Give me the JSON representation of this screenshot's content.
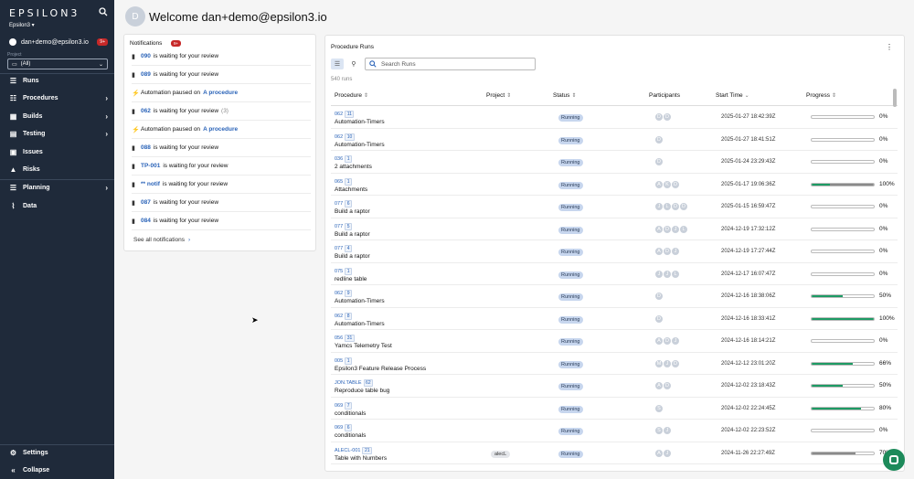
{
  "sidebar": {
    "logo": "EPSILON3",
    "org": "Epsilon3 ▾",
    "user": "dan+demo@epsilon3.io",
    "user_badge": "9+",
    "project_label": "Project",
    "project_value": "(All)",
    "items": [
      {
        "label": "Runs",
        "icon": "play-icon"
      },
      {
        "label": "Procedures",
        "icon": "list-icon"
      },
      {
        "label": "Builds",
        "icon": "cubes-icon"
      },
      {
        "label": "Testing",
        "icon": "clipboard-icon"
      },
      {
        "label": "Issues",
        "icon": "inbox-icon"
      },
      {
        "label": "Risks",
        "icon": "warning-icon"
      },
      {
        "label": "Planning",
        "icon": "calendar-icon"
      },
      {
        "label": "Data",
        "icon": "chart-icon"
      }
    ],
    "settings": "Settings",
    "collapse": "Collapse"
  },
  "header": {
    "avatar": "D",
    "welcome": "Welcome dan+demo@epsilon3.io"
  },
  "notifications": {
    "title": "Notifications",
    "badge": "9+",
    "items": [
      {
        "link": "090",
        "text": "is waiting for your review",
        "icon": "clipboard-icon"
      },
      {
        "link": "089",
        "text": "is waiting for your review",
        "icon": "clipboard-icon"
      },
      {
        "text": "Automation paused on",
        "link2": "A procedure",
        "icon": "bolt-icon"
      },
      {
        "link": "062",
        "text": "is waiting for your review",
        "count": "(3)",
        "icon": "clipboard-icon"
      },
      {
        "text": "Automation paused on",
        "link2": "A procedure",
        "icon": "bolt-icon"
      },
      {
        "link": "088",
        "text": "is waiting for your review",
        "icon": "clipboard-icon"
      },
      {
        "link": "TP-001",
        "text": "is waiting for your review",
        "icon": "clipboard-icon"
      },
      {
        "link": "** notif",
        "text": "is waiting for your review",
        "icon": "clipboard-icon"
      },
      {
        "link": "087",
        "text": "is waiting for your review",
        "icon": "clipboard-icon"
      },
      {
        "link": "084",
        "text": "is waiting for your review",
        "icon": "clipboard-icon"
      }
    ],
    "see_all": "See all notifications"
  },
  "runs": {
    "title": "Procedure Runs",
    "search_placeholder": "Search Runs",
    "count": "540 runs",
    "columns": [
      "Procedure",
      "Project",
      "Status",
      "Participants",
      "Start Time",
      "Progress"
    ],
    "rows": [
      {
        "id": "062",
        "num": "11",
        "name": "Automation-Timers",
        "project": "",
        "status": "Running",
        "parts": [
          "D",
          "D"
        ],
        "time": "2025-01-27 18:42:39Z",
        "progress": 0,
        "pct": "0%"
      },
      {
        "id": "062",
        "num": "10",
        "name": "Automation-Timers",
        "project": "",
        "status": "Running",
        "parts": [
          "D"
        ],
        "time": "2025-01-27 18:41:51Z",
        "progress": 0,
        "pct": "0%"
      },
      {
        "id": "036",
        "num": "1",
        "name": "2 attachments",
        "project": "",
        "status": "Running",
        "parts": [
          "D"
        ],
        "time": "2025-01-24 23:29:43Z",
        "progress": 0,
        "pct": "0%"
      },
      {
        "id": "065",
        "num": "1",
        "name": "Attachments",
        "project": "",
        "status": "Running",
        "parts": [
          "A",
          "K",
          "D"
        ],
        "time": "2025-01-17 19:06:36Z",
        "progress": 0.3,
        "progress2": 0.7,
        "pct": "100%"
      },
      {
        "id": "077",
        "num": "6",
        "name": "Build a raptor",
        "project": "",
        "status": "Running",
        "parts": [
          "J",
          "L",
          "D",
          "D"
        ],
        "time": "2025-01-15 16:59:47Z",
        "progress": 0,
        "pct": "0%"
      },
      {
        "id": "077",
        "num": "5",
        "name": "Build a raptor",
        "project": "",
        "status": "Running",
        "parts": [
          "A",
          "D",
          "J",
          "L"
        ],
        "time": "2024-12-19 17:32:12Z",
        "progress": 0,
        "pct": "0%"
      },
      {
        "id": "077",
        "num": "4",
        "name": "Build a raptor",
        "project": "",
        "status": "Running",
        "parts": [
          "A",
          "D",
          "J"
        ],
        "time": "2024-12-19 17:27:44Z",
        "progress": 0,
        "pct": "0%"
      },
      {
        "id": "075",
        "num": "1",
        "name": "redline table",
        "project": "",
        "status": "Running",
        "parts": [
          "J",
          "J",
          "L"
        ],
        "time": "2024-12-17 16:07:47Z",
        "progress": 0,
        "pct": "0%"
      },
      {
        "id": "062",
        "num": "9",
        "name": "Automation-Timers",
        "project": "",
        "status": "Running",
        "parts": [
          "D"
        ],
        "time": "2024-12-16 18:38:06Z",
        "progress": 0.5,
        "pct": "50%"
      },
      {
        "id": "062",
        "num": "8",
        "name": "Automation-Timers",
        "project": "",
        "status": "Running",
        "parts": [
          "D"
        ],
        "time": "2024-12-16 18:33:41Z",
        "progress": 1,
        "pct": "100%"
      },
      {
        "id": "056",
        "num": "31",
        "name": "Yamcs Telemetry Test",
        "project": "",
        "status": "Running",
        "parts": [
          "A",
          "D",
          "J"
        ],
        "time": "2024-12-16 18:14:21Z",
        "progress": 0,
        "pct": "0%"
      },
      {
        "id": "005",
        "num": "1",
        "name": "Epsilon3 Feature Release Process",
        "project": "",
        "status": "Running",
        "parts": [
          "M",
          "J",
          "D"
        ],
        "time": "2024-12-12 23:01:20Z",
        "progress": 0.66,
        "pct": "66%"
      },
      {
        "id": "JON.TABLE",
        "num": "62",
        "name": "Reproduce table bug",
        "project": "",
        "status": "Running",
        "parts": [
          "A",
          "D"
        ],
        "time": "2024-12-02 23:18:43Z",
        "progress": 0.5,
        "pct": "50%"
      },
      {
        "id": "069",
        "num": "7",
        "name": "conditionals",
        "project": "",
        "status": "Running",
        "parts": [
          "S"
        ],
        "time": "2024-12-02 22:24:45Z",
        "progress": 0.8,
        "pct": "80%"
      },
      {
        "id": "069",
        "num": "6",
        "name": "conditionals",
        "project": "",
        "status": "Running",
        "parts": [
          "S",
          "J"
        ],
        "time": "2024-12-02 22:23:52Z",
        "progress": 0,
        "pct": "0%"
      },
      {
        "id": "ALECL-001",
        "num": "21",
        "name": "Table with Numbers",
        "project": "alecL",
        "status": "Running",
        "parts": [
          "A",
          "J"
        ],
        "time": "2024-11-26 22:27:49Z",
        "progress": 0,
        "progress2": 0.7,
        "pct": "70%"
      }
    ]
  },
  "colors": {
    "sidebar_bg": "#1f2a3a",
    "link": "#2a63b8",
    "progress_green": "#1d9b64",
    "badge_red": "#c62828"
  }
}
